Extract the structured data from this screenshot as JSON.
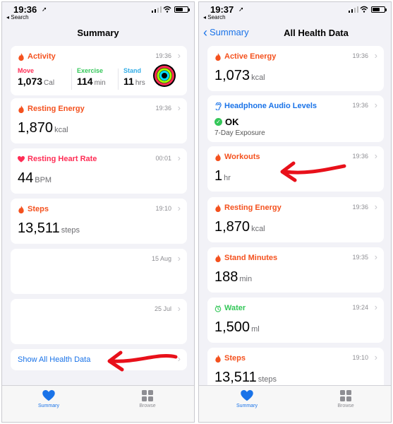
{
  "left": {
    "status": {
      "time": "19:36",
      "back": "◂ Search"
    },
    "nav": {
      "title": "Summary"
    },
    "activity": {
      "title": "Activity",
      "time": "19:36",
      "move": {
        "label": "Move",
        "value": "1,073",
        "unit": "Cal"
      },
      "exercise": {
        "label": "Exercise",
        "value": "114",
        "unit": "min"
      },
      "stand": {
        "label": "Stand",
        "value": "11",
        "unit": "hrs"
      }
    },
    "resting_energy": {
      "title": "Resting Energy",
      "time": "19:36",
      "value": "1,870",
      "unit": "kcal"
    },
    "resting_heart_rate": {
      "title": "Resting Heart Rate",
      "time": "00:01",
      "value": "44",
      "unit": "BPM"
    },
    "steps": {
      "title": "Steps",
      "time": "19:10",
      "value": "13,511",
      "unit": "steps"
    },
    "empty1": {
      "time": "15 Aug"
    },
    "empty2": {
      "time": "25 Jul"
    },
    "show_all": "Show All Health Data",
    "tabs": {
      "summary": "Summary",
      "browse": "Browse"
    }
  },
  "right": {
    "status": {
      "time": "19:37",
      "back": "◂ Search"
    },
    "nav": {
      "back": "Summary",
      "title": "All Health Data"
    },
    "active_energy": {
      "title": "Active Energy",
      "time": "19:36",
      "value": "1,073",
      "unit": "kcal"
    },
    "headphone": {
      "title": "Headphone Audio Levels",
      "time": "19:36",
      "status": "OK",
      "sub": "7-Day Exposure"
    },
    "workouts": {
      "title": "Workouts",
      "time": "19:36",
      "value": "1",
      "unit": "hr"
    },
    "resting_energy": {
      "title": "Resting Energy",
      "time": "19:36",
      "value": "1,870",
      "unit": "kcal"
    },
    "stand_minutes": {
      "title": "Stand Minutes",
      "time": "19:35",
      "value": "188",
      "unit": "min"
    },
    "water": {
      "title": "Water",
      "time": "19:24",
      "value": "1,500",
      "unit": "ml"
    },
    "steps": {
      "title": "Steps",
      "time": "19:10",
      "value": "13,511",
      "unit": "steps"
    },
    "tabs": {
      "summary": "Summary",
      "browse": "Browse"
    }
  },
  "colors": {
    "accent_blue": "#1a73e8",
    "orange": "#f4511e",
    "pink": "#ff2d55",
    "green": "#34c759",
    "arrow_red": "#e8101a"
  },
  "icons": {
    "flame": "flame-icon",
    "heart": "heart-icon",
    "ear": "ear-icon",
    "water": "water-drop-icon",
    "rings": "activity-rings-icon",
    "grid": "browse-grid-icon"
  }
}
